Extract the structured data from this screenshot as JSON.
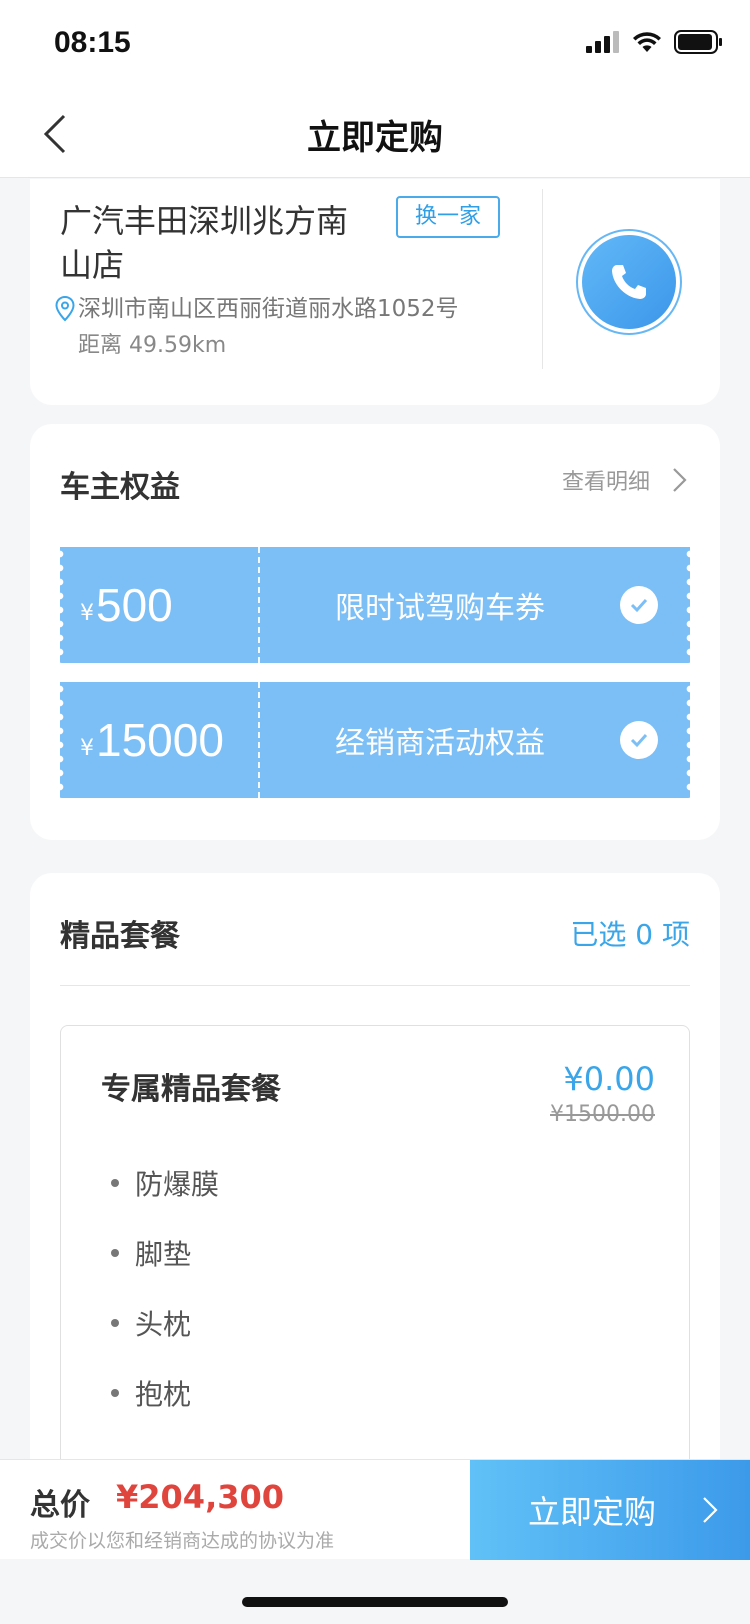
{
  "status_bar": {
    "time": "08:15"
  },
  "nav": {
    "title": "立即定购"
  },
  "dealer": {
    "name": "广汽丰田深圳兆方南山店",
    "switch_label": "换一家",
    "address": "深圳市南山区西丽街道丽水路1052号",
    "distance": "距离 49.59km"
  },
  "benefits": {
    "title": "车主权益",
    "detail_link": "查看明细",
    "coupons": [
      {
        "currency": "¥",
        "amount": "500",
        "label": "限时试驾购车券",
        "checked": true
      },
      {
        "currency": "¥",
        "amount": "15000",
        "label": "经销商活动权益",
        "checked": true
      }
    ]
  },
  "package": {
    "title": "精品套餐",
    "selected": "已选 0 项",
    "item": {
      "name": "专属精品套餐",
      "price": "¥0.00",
      "original_price": "¥1500.00",
      "features": [
        "防爆膜",
        "脚垫",
        "头枕",
        "抱枕"
      ]
    }
  },
  "bottom": {
    "total_label": "总价",
    "total_price": "¥204,300",
    "note": "成交价以您和经销商达成的协议为准",
    "order_button": "立即定购"
  },
  "colors": {
    "accent": "#3aa5e8",
    "coupon": "#7cbff6",
    "price_red": "#e0453d"
  }
}
